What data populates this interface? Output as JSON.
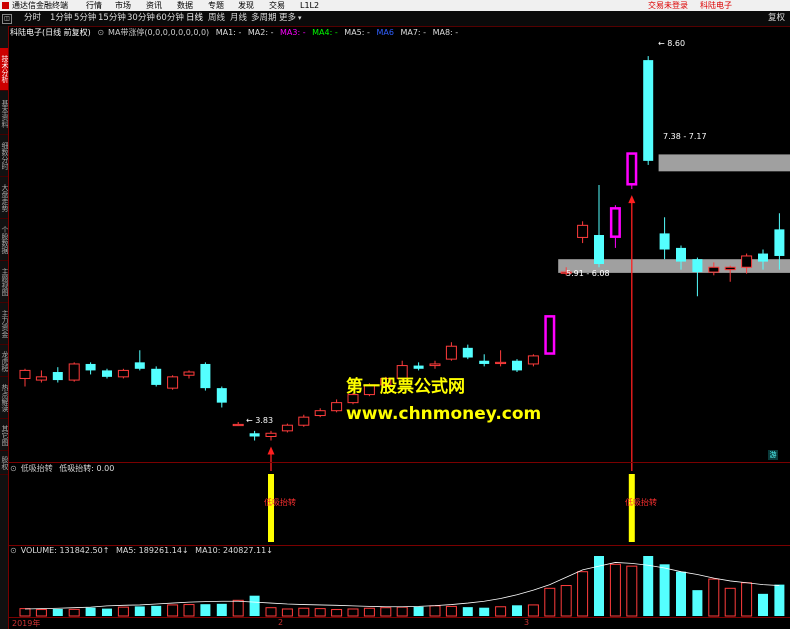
{
  "app": {
    "title": "通达信金融终端",
    "menu": [
      "行情",
      "市场",
      "资讯",
      "数据",
      "专题",
      "发现",
      "交易",
      "L1L2"
    ],
    "login_status": "交易未登录",
    "stock_name": "科陆电子"
  },
  "periods": {
    "items": [
      "分时",
      "1分钟",
      "5分钟",
      "15分钟",
      "30分钟",
      "60分钟",
      "日线",
      "周线",
      "月线",
      "多周期",
      "更多"
    ],
    "active": "日线",
    "fq_label": "复权"
  },
  "left_tabs": [
    "技术分析",
    "基本资料",
    "细数分时",
    "大盘走势",
    "个股数据",
    "主题视图",
    "主力资金",
    "龙虎榜",
    "热点解读",
    "其它图",
    "股权"
  ],
  "main_legend": {
    "title": "科陆电子(日线 前复权)",
    "indicator": "MA带涨停(0,0,0,0,0,0,0,0)",
    "ma": [
      {
        "label": "MA1: -",
        "color": "#dddddd"
      },
      {
        "label": "MA2: -",
        "color": "#dddddd"
      },
      {
        "label": "MA3: -",
        "color": "#ff00ff"
      },
      {
        "label": "MA4: -",
        "color": "#00ff00"
      },
      {
        "label": "MA5: -",
        "color": "#dddddd"
      },
      {
        "label": "MA6",
        "color": "#3060ff"
      },
      {
        "label": "MA7: -",
        "color": "#dddddd"
      },
      {
        "label": "MA8: -",
        "color": "#dddddd"
      }
    ]
  },
  "price_annotations": {
    "high": "8.60",
    "low": "3.83",
    "zone_upper": "7.38 - 7.17",
    "zone_lower": "5.91 - 6.08"
  },
  "watermark": {
    "line1": "第一股票公式网",
    "line2": "www.chnmoney.com"
  },
  "signal_panel": {
    "title": "低吸抬转",
    "value_label": "低吸抬转: 0.00",
    "signal_label": "低吸抬转"
  },
  "volume_panel": {
    "title": "VOLUME: 131842.50↑",
    "ma5": "MA5: 189261.14↓",
    "ma10": "MA10: 240827.11↓"
  },
  "x_axis": {
    "labels": [
      "2019年",
      "2",
      "3"
    ]
  },
  "side_button": "游",
  "colors": {
    "up": "#ff3c3c",
    "down": "#54ffff",
    "limit_up": "#ff00ff",
    "zone": "#a0a0a0",
    "signal": "#ffff00",
    "arrow": "#ff2020"
  },
  "chart_data": {
    "type": "candlestick",
    "candles": [
      {
        "o": 4.6,
        "c": 4.7,
        "h": 4.72,
        "l": 4.5
      },
      {
        "o": 4.58,
        "c": 4.62,
        "h": 4.7,
        "l": 4.55
      },
      {
        "o": 4.68,
        "c": 4.58,
        "h": 4.74,
        "l": 4.55
      },
      {
        "o": 4.58,
        "c": 4.78,
        "h": 4.8,
        "l": 4.56
      },
      {
        "o": 4.78,
        "c": 4.7,
        "h": 4.8,
        "l": 4.65
      },
      {
        "o": 4.7,
        "c": 4.62,
        "h": 4.72,
        "l": 4.6
      },
      {
        "o": 4.62,
        "c": 4.7,
        "h": 4.72,
        "l": 4.6
      },
      {
        "o": 4.8,
        "c": 4.72,
        "h": 4.95,
        "l": 4.7
      },
      {
        "o": 4.72,
        "c": 4.52,
        "h": 4.75,
        "l": 4.5
      },
      {
        "o": 4.48,
        "c": 4.62,
        "h": 4.64,
        "l": 4.46
      },
      {
        "o": 4.64,
        "c": 4.68,
        "h": 4.7,
        "l": 4.6
      },
      {
        "o": 4.78,
        "c": 4.48,
        "h": 4.8,
        "l": 4.45
      },
      {
        "o": 4.48,
        "c": 4.3,
        "h": 4.5,
        "l": 4.24
      },
      {
        "o": 4.03,
        "c": 4.03,
        "h": 4.06,
        "l": 4.01
      },
      {
        "o": 3.92,
        "c": 3.88,
        "h": 3.95,
        "l": 3.83
      },
      {
        "o": 3.88,
        "c": 3.92,
        "h": 3.95,
        "l": 3.83
      },
      {
        "o": 3.95,
        "c": 4.02,
        "h": 4.04,
        "l": 3.93
      },
      {
        "o": 4.02,
        "c": 4.12,
        "h": 4.15,
        "l": 4.0
      },
      {
        "o": 4.14,
        "c": 4.2,
        "h": 4.23,
        "l": 4.12
      },
      {
        "o": 4.2,
        "c": 4.3,
        "h": 4.34,
        "l": 4.18
      },
      {
        "o": 4.3,
        "c": 4.4,
        "h": 4.42,
        "l": 4.28
      },
      {
        "o": 4.4,
        "c": 4.52,
        "h": 4.54,
        "l": 4.38
      },
      {
        "o": 4.52,
        "c": 4.6,
        "h": 4.62,
        "l": 4.5
      },
      {
        "o": 4.6,
        "c": 4.76,
        "h": 4.82,
        "l": 4.58
      },
      {
        "o": 4.76,
        "c": 4.72,
        "h": 4.8,
        "l": 4.7
      },
      {
        "o": 4.76,
        "c": 4.78,
        "h": 4.82,
        "l": 4.72
      },
      {
        "o": 4.84,
        "c": 5.0,
        "h": 5.05,
        "l": 4.82
      },
      {
        "o": 4.98,
        "c": 4.86,
        "h": 5.02,
        "l": 4.84
      },
      {
        "o": 4.82,
        "c": 4.78,
        "h": 4.9,
        "l": 4.75
      },
      {
        "o": 4.8,
        "c": 4.8,
        "h": 4.95,
        "l": 4.75
      },
      {
        "o": 4.82,
        "c": 4.7,
        "h": 4.84,
        "l": 4.68
      },
      {
        "o": 4.78,
        "c": 4.88,
        "h": 4.9,
        "l": 4.75
      },
      {
        "o": 4.9,
        "c": 5.38,
        "h": 5.38,
        "l": 4.9
      },
      {
        "o": 5.92,
        "c": 5.92,
        "h": 5.98,
        "l": 5.88
      },
      {
        "o": 6.35,
        "c": 6.5,
        "h": 6.55,
        "l": 6.28
      },
      {
        "o": 6.38,
        "c": 6.02,
        "h": 7.0,
        "l": 5.98
      },
      {
        "o": 6.35,
        "c": 6.72,
        "h": 6.75,
        "l": 6.22
      },
      {
        "o": 7.0,
        "c": 7.4,
        "h": 7.4,
        "l": 6.95
      },
      {
        "o": 8.55,
        "c": 7.3,
        "h": 8.6,
        "l": 7.25
      },
      {
        "o": 6.4,
        "c": 6.2,
        "h": 6.6,
        "l": 6.08
      },
      {
        "o": 6.22,
        "c": 6.05,
        "h": 6.25,
        "l": 5.95
      },
      {
        "o": 6.08,
        "c": 5.92,
        "h": 6.1,
        "l": 5.62
      },
      {
        "o": 5.92,
        "c": 5.98,
        "h": 6.04,
        "l": 5.88
      },
      {
        "o": 5.95,
        "c": 5.98,
        "h": 6.0,
        "l": 5.8
      },
      {
        "o": 5.98,
        "c": 6.12,
        "h": 6.15,
        "l": 5.9
      },
      {
        "o": 6.15,
        "c": 6.05,
        "h": 6.2,
        "l": 5.95
      },
      {
        "o": 6.45,
        "c": 6.12,
        "h": 6.65,
        "l": 5.95
      }
    ],
    "limit_up_indices": [
      32,
      36,
      37
    ],
    "volume": [
      40,
      35,
      38,
      36,
      45,
      40,
      48,
      52,
      55,
      60,
      62,
      64,
      66,
      85,
      110,
      45,
      38,
      42,
      40,
      35,
      38,
      42,
      45,
      48,
      50,
      55,
      52,
      48,
      45,
      50,
      58,
      60,
      150,
      165,
      240,
      325,
      280,
      270,
      325,
      280,
      240,
      140,
      200,
      150,
      180,
      120,
      170
    ],
    "volume_ma": [
      38,
      40,
      42,
      45,
      48,
      55,
      58,
      60,
      65,
      70,
      75,
      78,
      80,
      80,
      75,
      70,
      65,
      62,
      60,
      58,
      55,
      52,
      50,
      50,
      52,
      56,
      62,
      70,
      80,
      95,
      115,
      140,
      170,
      210,
      250,
      270,
      290,
      285,
      275,
      260,
      240,
      225,
      205,
      190,
      180,
      170,
      165
    ]
  }
}
